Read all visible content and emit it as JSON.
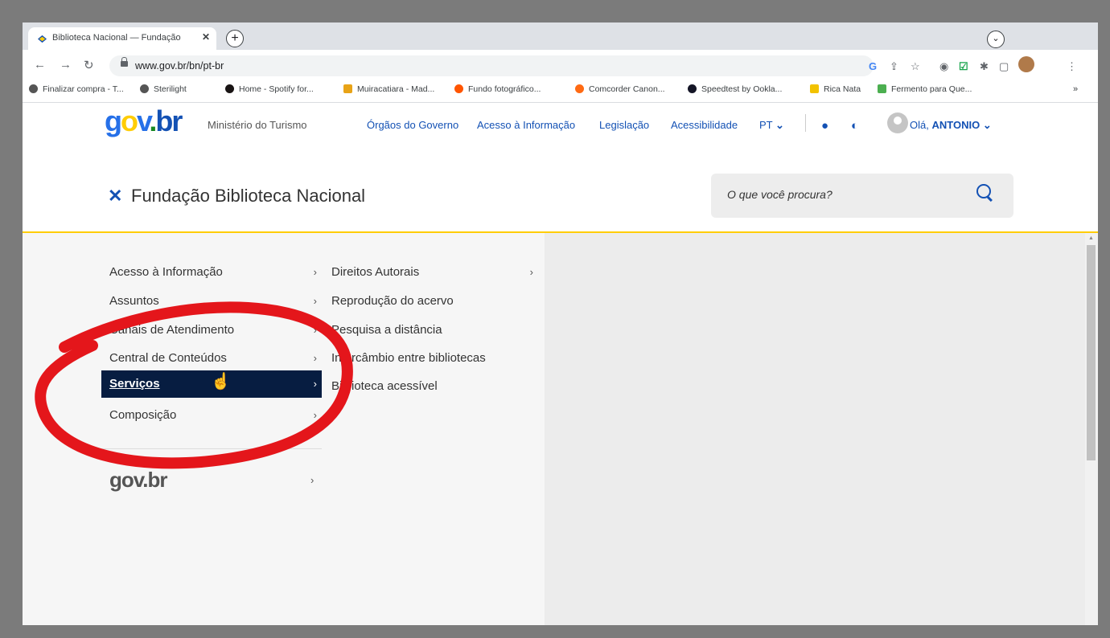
{
  "browser": {
    "tab_title": "Biblioteca Nacional — Fundação",
    "tab_close": "✕",
    "new_tab": "+",
    "tab_search": "⌄",
    "url": "www.gov.br/bn/pt-br",
    "more_bookmarks": "»",
    "bookmarks": [
      {
        "label": "Finalizar compra - T...",
        "color": "#555555"
      },
      {
        "label": "Sterilight",
        "color": "#555555"
      },
      {
        "label": "Home - Spotify for...",
        "color": "#191414"
      },
      {
        "label": "Muiracatiara - Mad...",
        "color": "#e8a317"
      },
      {
        "label": "Fundo fotográfico...",
        "color": "#ff5500"
      },
      {
        "label": "Comcorder Canon...",
        "color": "#ff6a13"
      },
      {
        "label": "Speedtest by Ookla...",
        "color": "#141526"
      },
      {
        "label": "Rica Nata",
        "color": "#f2c200"
      },
      {
        "label": "Fermento para Que...",
        "color": "#4caf50"
      }
    ]
  },
  "header": {
    "logo": {
      "g": "g",
      "o": "o",
      "v": "v",
      "dot": ".",
      "br": "br"
    },
    "ministry": "Ministério do Turismo",
    "links": [
      "Órgãos do Governo",
      "Acesso à Informação",
      "Legislação",
      "Acessibilidade"
    ],
    "language": "PT",
    "greeting": "Olá,",
    "user": "ANTONIO",
    "site_name": "Fundação Biblioteca Nacional",
    "search_placeholder": "O que você procura?"
  },
  "menu": {
    "primary": [
      {
        "label": "Acesso à Informação",
        "chevron": "›"
      },
      {
        "label": "Assuntos",
        "chevron": "›"
      },
      {
        "label": "Canais de Atendimento",
        "chevron": "›"
      },
      {
        "label": "Central de Conteúdos",
        "chevron": "›"
      },
      {
        "label": "Serviços",
        "chevron": "›",
        "active": true
      },
      {
        "label": "Composição",
        "chevron": "›"
      }
    ],
    "secondary": [
      {
        "label": "Direitos Autorais",
        "chevron": "›"
      },
      {
        "label": "Reprodução do acervo",
        "chevron": ""
      },
      {
        "label": "Pesquisa a distância",
        "chevron": ""
      },
      {
        "label": "Intercâmbio entre bibliotecas",
        "chevron": ""
      },
      {
        "label": "Biblioteca acessível",
        "chevron": ""
      }
    ],
    "govbr_label": "gov.br",
    "govbr_chevron": "›"
  },
  "colors": {
    "accent": "#1351b4",
    "active_bg": "#071d41",
    "header_line": "#ffcd07",
    "annotation": "#e4161b"
  }
}
